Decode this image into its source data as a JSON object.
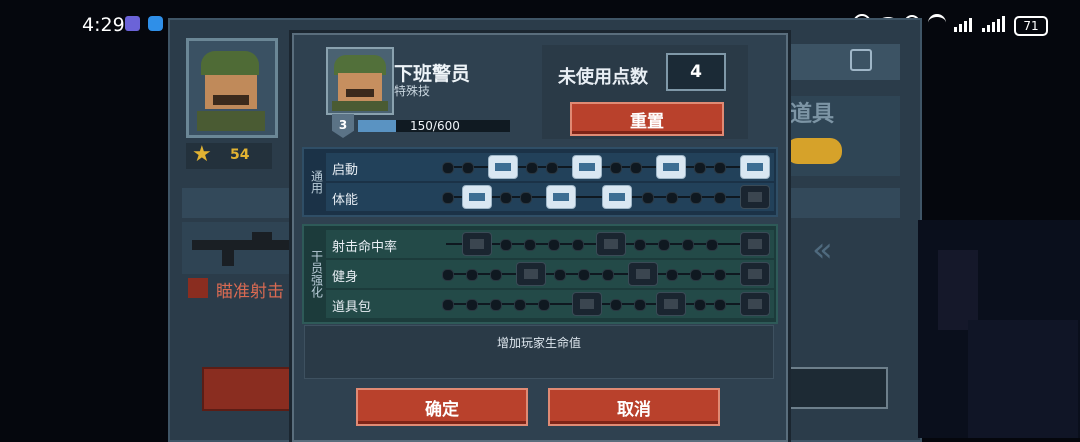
{
  "status_bar": {
    "time": "4:29",
    "battery": "71",
    "icons": [
      "app-badge-icon",
      "app-badge-icon-2",
      "nfc-icon",
      "eye-icon",
      "alarm-icon",
      "wifi-icon",
      "signal-icon",
      "signal-icon-2",
      "battery-icon"
    ]
  },
  "background": {
    "level": "54",
    "aim_label": "瞄准射击",
    "tools_label": "道具"
  },
  "dialog": {
    "name": "下班警员",
    "subtitle": "特殊技",
    "level": "3",
    "xp_text": "150/600",
    "xp_fraction": 0.25,
    "points_label": "未使用点数",
    "points_value": "4",
    "reset_label": "重置",
    "sections": [
      {
        "label": "通用",
        "rows": [
          {
            "label": "启動"
          },
          {
            "label": "体能"
          }
        ]
      },
      {
        "label": "干员强化",
        "rows": [
          {
            "label": "射击命中率"
          },
          {
            "label": "健身"
          },
          {
            "label": "道具包"
          }
        ]
      }
    ],
    "description": "增加玩家生命值",
    "confirm_label": "确定",
    "cancel_label": "取消"
  },
  "colors": {
    "button_red": "#b9412c",
    "panel": "#2f4150",
    "xp_bar": "#5a93c2"
  }
}
